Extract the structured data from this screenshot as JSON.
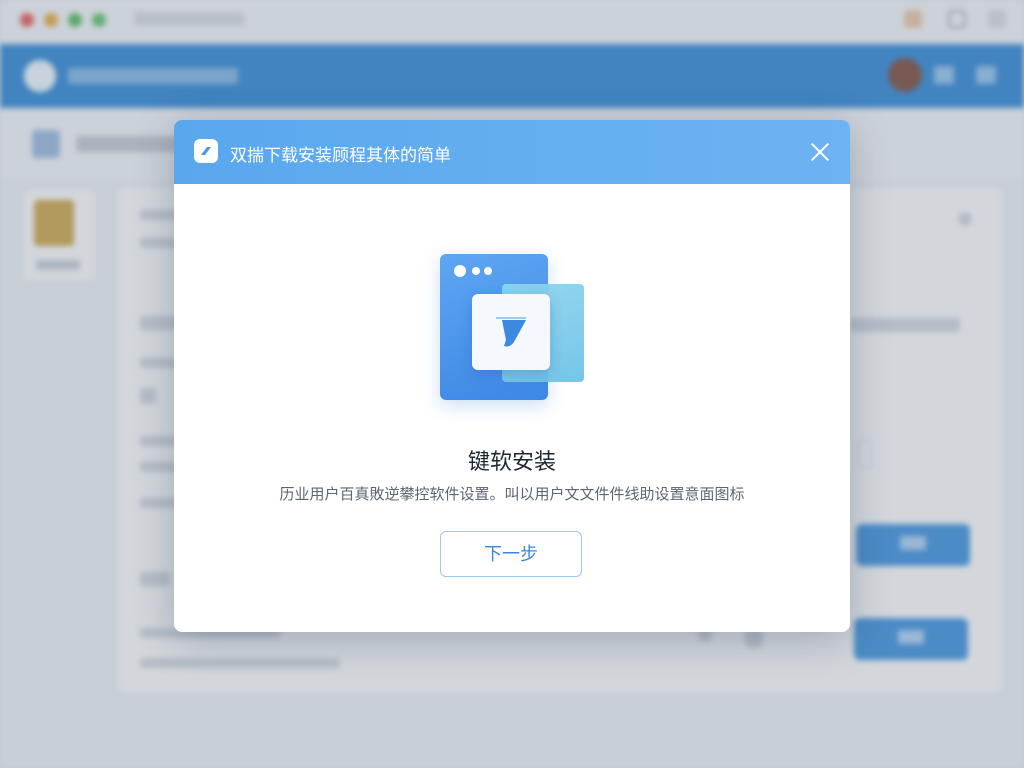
{
  "modal": {
    "title": "双揣下载安装顾程其体的简单",
    "heading": "键软安装",
    "description": "历业用户百真敗逆攀控软件设置。叫以用户文文件件线助设置意面图标",
    "next_button": "下一步"
  },
  "colors": {
    "header_blue": "#5aa7ee",
    "app_bar_blue": "#2d86d3",
    "button_text": "#3a87db",
    "button_border": "#9cc8f2"
  },
  "icons": {
    "modal_logo": "app-logo-icon",
    "close": "close-icon",
    "illustration": "install-window-illustration"
  }
}
